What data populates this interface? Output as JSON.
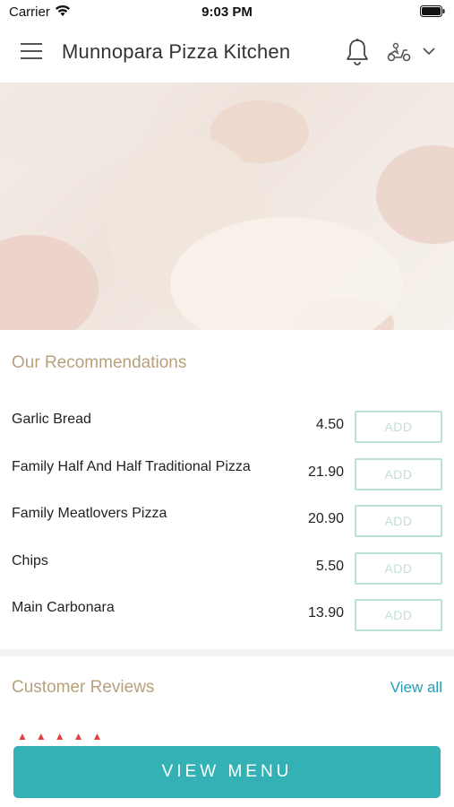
{
  "status_bar": {
    "carrier": "Carrier",
    "time": "9:03 PM"
  },
  "header": {
    "title": "Munnopara Pizza Kitchen"
  },
  "icons": {
    "menu": "hamburger-menu-icon",
    "notifications": "bell-icon",
    "delivery_mode": "scooter-icon",
    "dropdown": "chevron-down-icon"
  },
  "recommendations": {
    "title": "Our Recommendations",
    "add_label": "ADD",
    "items": [
      {
        "name": "Garlic Bread",
        "price": "4.50"
      },
      {
        "name": "Family Half And Half Traditional Pizza",
        "price": "21.90"
      },
      {
        "name": "Family Meatlovers Pizza",
        "price": "20.90"
      },
      {
        "name": "Chips",
        "price": "5.50"
      },
      {
        "name": "Main Carbonara",
        "price": "13.90"
      }
    ]
  },
  "reviews": {
    "title": "Customer Reviews",
    "view_all": "View all",
    "first_rating": 5
  },
  "footer": {
    "view_menu": "VIEW MENU"
  },
  "colors": {
    "accent_teal": "#33b1b4",
    "section_title_gold": "#b7a17d",
    "link_blue": "#2a9bb5",
    "add_border": "#b9e1d4"
  }
}
